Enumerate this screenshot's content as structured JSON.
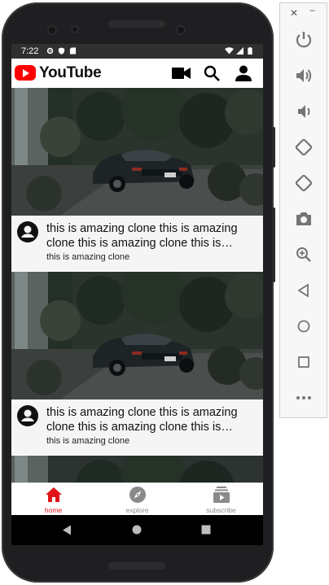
{
  "status_bar": {
    "time": "7:22"
  },
  "app_bar": {
    "title": "YouTube"
  },
  "feed": {
    "videos": [
      {
        "title": "this is amazing clone this is amazing clone this is amazing clone this is amazing clone",
        "channel": "this is amazing clone"
      },
      {
        "title": "this is amazing clone this is amazing clone this is amazing clone this is amazing clone",
        "channel": "this is amazing clone"
      }
    ]
  },
  "bottom_nav": {
    "items": [
      {
        "label": "home",
        "icon": "home-icon",
        "active": true
      },
      {
        "label": "explore",
        "icon": "compass-icon",
        "active": false
      },
      {
        "label": "subscribe",
        "icon": "subscriptions-icon",
        "active": false
      }
    ],
    "active_color": "#e0141a",
    "inactive_color": "#8a8a8a"
  },
  "emulator_toolbar": {
    "buttons": [
      "power-icon",
      "volume-up-icon",
      "volume-down-icon",
      "rotate-left-icon",
      "rotate-right-icon",
      "camera-icon",
      "zoom-icon",
      "back-icon",
      "home-circle-icon",
      "overview-icon",
      "more-icon"
    ]
  }
}
